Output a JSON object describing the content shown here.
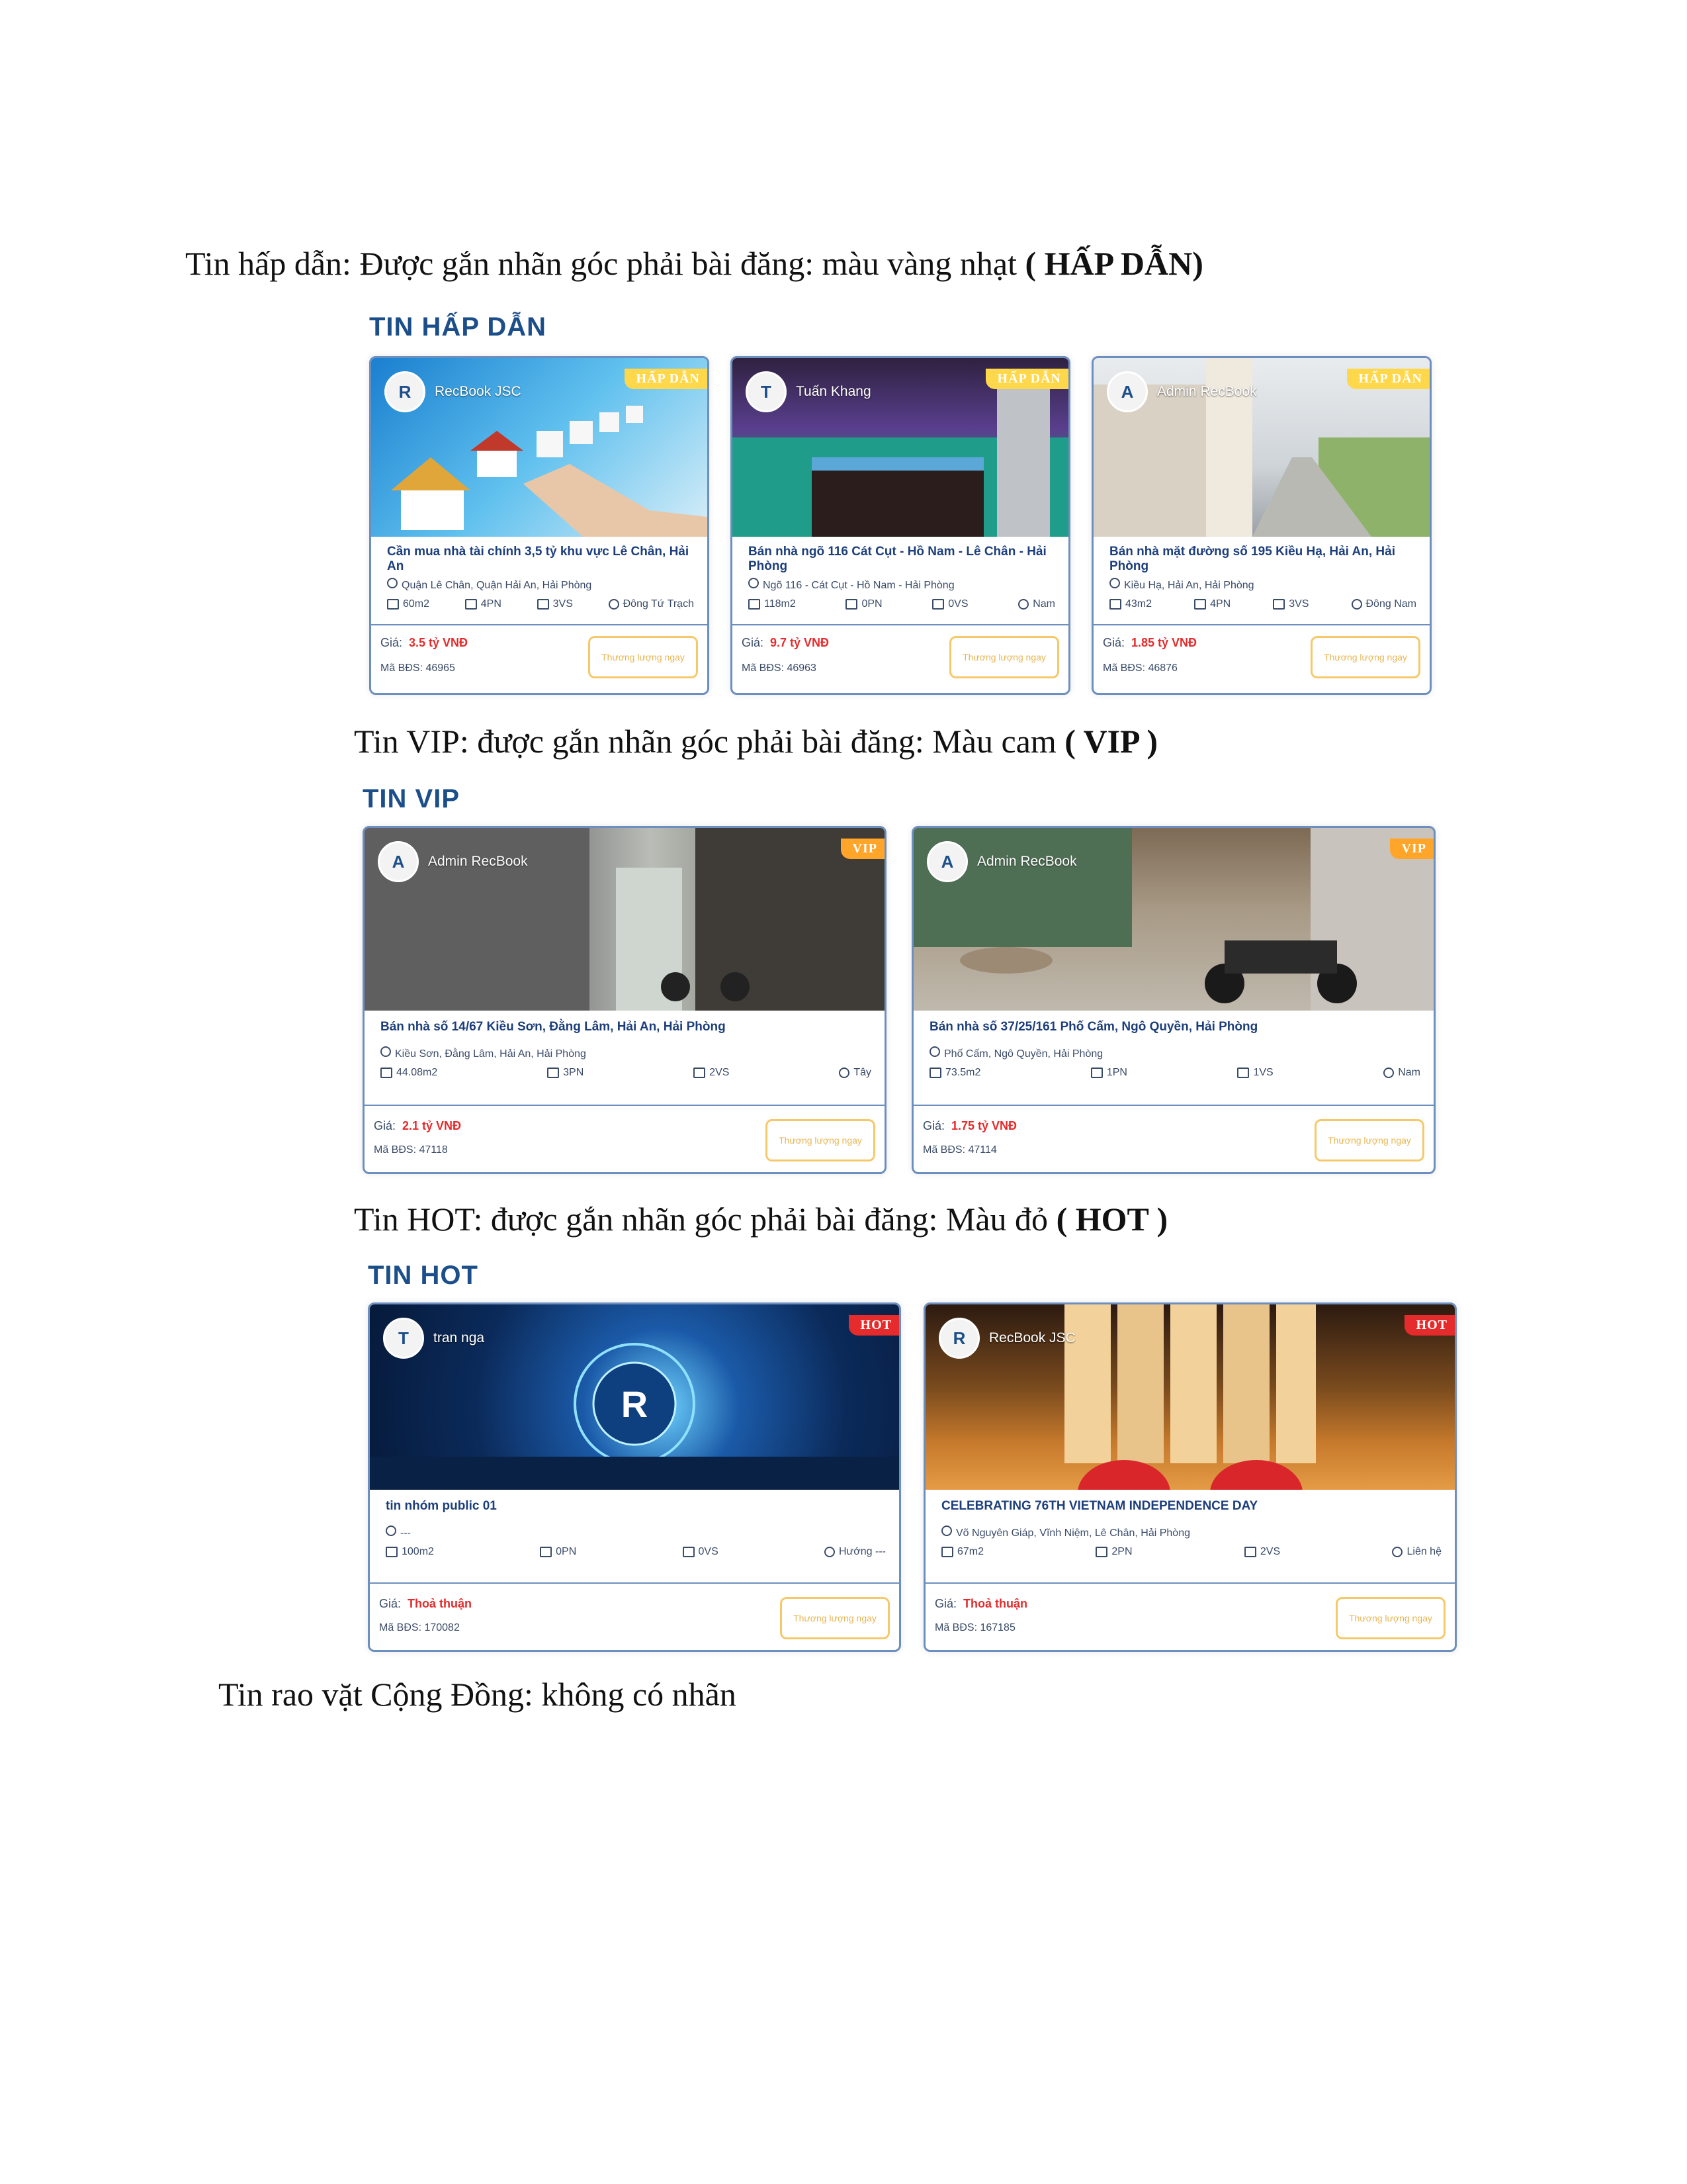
{
  "paragraphs": {
    "hapdan": {
      "text": "Tin hấp dẫn: Được gắn nhãn góc phải bài đăng: màu vàng nhạt ",
      "bold": "( HẤP DẪN)"
    },
    "vip": {
      "text": "Tin VIP: được gắn nhãn góc phải bài đăng: Màu cam ",
      "bold": "( VIP )"
    },
    "hot": {
      "text": "Tin HOT: được gắn nhãn góc phải bài đăng: Màu đỏ ",
      "bold": "( HOT )"
    },
    "community": {
      "text": "Tin rao vặt Cộng Đồng: không có nhãn"
    }
  },
  "sections": {
    "hapdan": {
      "title": "TIN HẤP DẪN",
      "cards": [
        {
          "owner": "RecBook JSC",
          "badge": "HẤP DẪN",
          "title": "Cần mua nhà tài chính 3,5 tỷ khu vực Lê Chân, Hải An",
          "address": "Quận Lê Chân, Quận Hải An, Hải Phòng",
          "area": "60m2",
          "bedrooms": "4PN",
          "bathrooms": "3VS",
          "direction": "Đông Tứ Trạch",
          "price_label": "Giá:",
          "price": "3.5 tỷ VNĐ",
          "code": "Mã BĐS: 46965",
          "button": "Thương lượng ngay"
        },
        {
          "owner": "Tuấn Khang",
          "badge": "HẤP DẪN",
          "title": "Bán nhà ngõ 116 Cát Cụt - Hồ Nam - Lê Chân - Hải Phòng",
          "address": "Ngõ 116 - Cát Cụt - Hồ Nam - Hải Phòng",
          "area": "118m2",
          "bedrooms": "0PN",
          "bathrooms": "0VS",
          "direction": "Nam",
          "price_label": "Giá:",
          "price": "9.7 tỷ VNĐ",
          "code": "Mã BĐS: 46963",
          "button": "Thương lượng ngay"
        },
        {
          "owner": "Admin RecBook",
          "badge": "HẤP DẪN",
          "title": "Bán nhà mặt đường số 195 Kiều Hạ, Hải An, Hải Phòng",
          "address": "Kiều Hạ, Hải An, Hải Phòng",
          "area": "43m2",
          "bedrooms": "4PN",
          "bathrooms": "3VS",
          "direction": "Đông Nam",
          "price_label": "Giá:",
          "price": "1.85 tỷ VNĐ",
          "code": "Mã BĐS: 46876",
          "button": "Thương lượng ngay"
        }
      ]
    },
    "vip": {
      "title": "TIN VIP",
      "cards": [
        {
          "owner": "Admin RecBook",
          "badge": "VIP",
          "title": "Bán nhà số 14/67 Kiều Sơn, Đằng Lâm, Hải An, Hải Phòng",
          "address": "Kiều Sơn, Đằng Lâm, Hải An, Hải Phòng",
          "area": "44.08m2",
          "bedrooms": "3PN",
          "bathrooms": "2VS",
          "direction": "Tây",
          "price_label": "Giá:",
          "price": "2.1 tỷ VNĐ",
          "code": "Mã BĐS: 47118",
          "button": "Thương lượng ngay"
        },
        {
          "owner": "Admin RecBook",
          "badge": "VIP",
          "title": "Bán nhà số 37/25/161 Phố Cấm, Ngô Quyền, Hải Phòng",
          "address": "Phố Cấm, Ngô Quyền, Hải Phòng",
          "area": "73.5m2",
          "bedrooms": "1PN",
          "bathrooms": "1VS",
          "direction": "Nam",
          "price_label": "Giá:",
          "price": "1.75 tỷ VNĐ",
          "code": "Mã BĐS: 47114",
          "button": "Thương lượng ngay"
        }
      ]
    },
    "hot": {
      "title": "TIN HOT",
      "cards": [
        {
          "owner": "tran nga",
          "badge": "HOT",
          "title": "tin nhóm public 01",
          "address": "---",
          "area": "100m2",
          "bedrooms": "0PN",
          "bathrooms": "0VS",
          "direction": "Hướng ---",
          "price_label": "Giá:",
          "price": "Thoả thuận",
          "code": "Mã BĐS: 170082",
          "button": "Thương lượng ngay"
        },
        {
          "owner": "RecBook JSC",
          "badge": "HOT",
          "title": "CELEBRATING 76TH VIETNAM INDEPENDENCE DAY",
          "address": "Võ Nguyên Giáp, Vĩnh Niệm, Lê Chân, Hải Phòng",
          "area": "67m2",
          "bedrooms": "2PN",
          "bathrooms": "2VS",
          "direction": "Liên hệ",
          "price_label": "Giá:",
          "price": "Thoả thuận",
          "code": "Mã BĐS: 167185",
          "button": "Thương lượng ngay"
        }
      ]
    }
  },
  "colors": {
    "badge_hapdan": "#ffd74a",
    "badge_vip": "#ffa52a",
    "badge_hot": "#e52b2b",
    "title_blue": "#1c4f8a",
    "price_red": "#e52b2b"
  }
}
